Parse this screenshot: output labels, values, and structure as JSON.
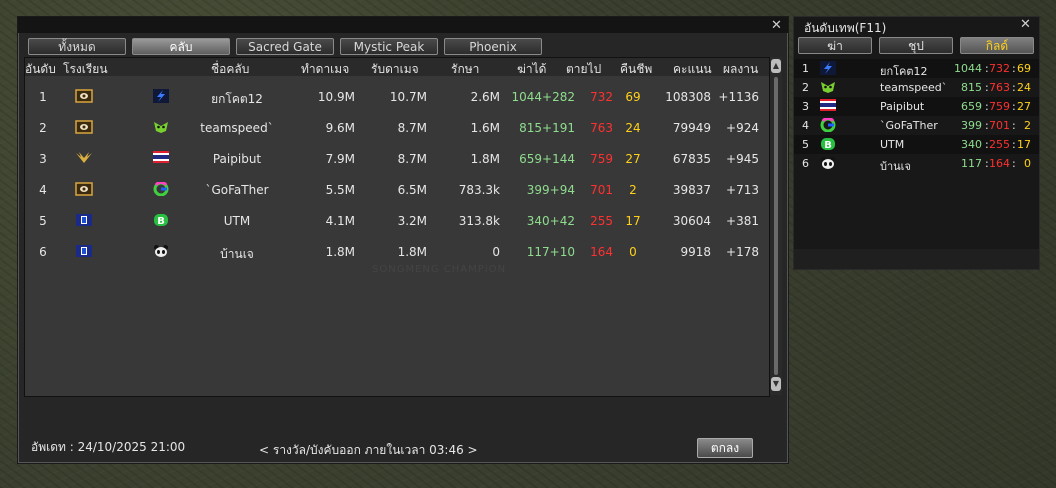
{
  "main": {
    "tabs": [
      "ทั้งหมด",
      "คลับ",
      "Sacred Gate",
      "Mystic Peak",
      "Phoenix"
    ],
    "active_tab": 1,
    "columns": [
      "อันดับ",
      "โรงเรียน",
      "ชื่อคลับ",
      "ทำดาเมจ",
      "รับดาเมจ",
      "รักษา",
      "ฆ่าได้",
      "ตายไป",
      "คืนชีพ",
      "คะแนน",
      "ผลงาน"
    ],
    "rows": [
      {
        "rank": "1",
        "school_icon": "school-crest-icon",
        "club_icon": "lightning-emblem-icon",
        "name": "ยกโคต12",
        "dmg_dealt": "10.9M",
        "dmg_taken": "10.7M",
        "heal": "2.6M",
        "kills": "1044+282",
        "deaths": "732",
        "revives": "69",
        "score": "108308",
        "merit": "+1136"
      },
      {
        "rank": "2",
        "school_icon": "school-crest-icon",
        "club_icon": "green-mask-emblem-icon",
        "name": "teamspeed`",
        "dmg_dealt": "9.6M",
        "dmg_taken": "8.7M",
        "heal": "1.6M",
        "kills": "815+191",
        "deaths": "763",
        "revives": "24",
        "score": "79949",
        "merit": "+924"
      },
      {
        "rank": "3",
        "school_icon": "golden-wings-icon",
        "club_icon": "thai-flag-icon",
        "name": "Paipibut",
        "dmg_dealt": "7.9M",
        "dmg_taken": "8.7M",
        "heal": "1.8M",
        "kills": "659+144",
        "deaths": "759",
        "revives": "27",
        "score": "67835",
        "merit": "+945"
      },
      {
        "rank": "4",
        "school_icon": "school-crest-icon",
        "club_icon": "g-logo-icon",
        "name": "`GoFaTher",
        "dmg_dealt": "5.5M",
        "dmg_taken": "6.5M",
        "heal": "783.3k",
        "kills": "399+94",
        "deaths": "701",
        "revives": "2",
        "score": "39837",
        "merit": "+713"
      },
      {
        "rank": "5",
        "school_icon": "blue-shield-icon",
        "club_icon": "green-b-emblem-icon",
        "name": "UTM",
        "dmg_dealt": "4.1M",
        "dmg_taken": "3.2M",
        "heal": "313.8k",
        "kills": "340+42",
        "deaths": "255",
        "revives": "17",
        "score": "30604",
        "merit": "+381"
      },
      {
        "rank": "6",
        "school_icon": "blue-shield-icon",
        "club_icon": "panda-emblem-icon",
        "name": "บ้านเจ",
        "dmg_dealt": "1.8M",
        "dmg_taken": "1.8M",
        "heal": "0",
        "kills": "117+10",
        "deaths": "164",
        "revives": "0",
        "score": "9918",
        "merit": "+178"
      }
    ],
    "updated": "อัพเดท : 24/10/2025 21:00",
    "reward_notice": "< รางวัล/บังคับออก ภายในเวลา 03:46 >",
    "ok_label": "ตกลง",
    "watermark": "SONGMENG CHAMPION"
  },
  "side": {
    "title": "อันดับเทพ(F11)",
    "tabs": [
      "ฆ่า",
      "ชุป",
      "กิลด์"
    ],
    "active_tab": 2,
    "rows": [
      {
        "rank": "1",
        "icon": "lightning-emblem-icon",
        "name": "ยกโคต12",
        "kills": "1044",
        "deaths": "732",
        "revives": "69"
      },
      {
        "rank": "2",
        "icon": "green-mask-emblem-icon",
        "name": "teamspeed`",
        "kills": "815",
        "deaths": "763",
        "revives": "24"
      },
      {
        "rank": "3",
        "icon": "thai-flag-icon",
        "name": "Paipibut",
        "kills": "659",
        "deaths": "759",
        "revives": "27"
      },
      {
        "rank": "4",
        "icon": "g-logo-icon",
        "name": "`GoFaTher",
        "kills": "399",
        "deaths": "701",
        "revives": "2"
      },
      {
        "rank": "5",
        "icon": "green-b-emblem-icon",
        "name": "UTM",
        "kills": "340",
        "deaths": "255",
        "revives": "17"
      },
      {
        "rank": "6",
        "icon": "panda-emblem-icon",
        "name": "บ้านเจ",
        "kills": "117",
        "deaths": "164",
        "revives": "0"
      }
    ],
    "sep": ":"
  },
  "colors": {
    "kills": "#8fdc8f",
    "deaths": "#ff3030",
    "revives": "#ffd21a"
  }
}
